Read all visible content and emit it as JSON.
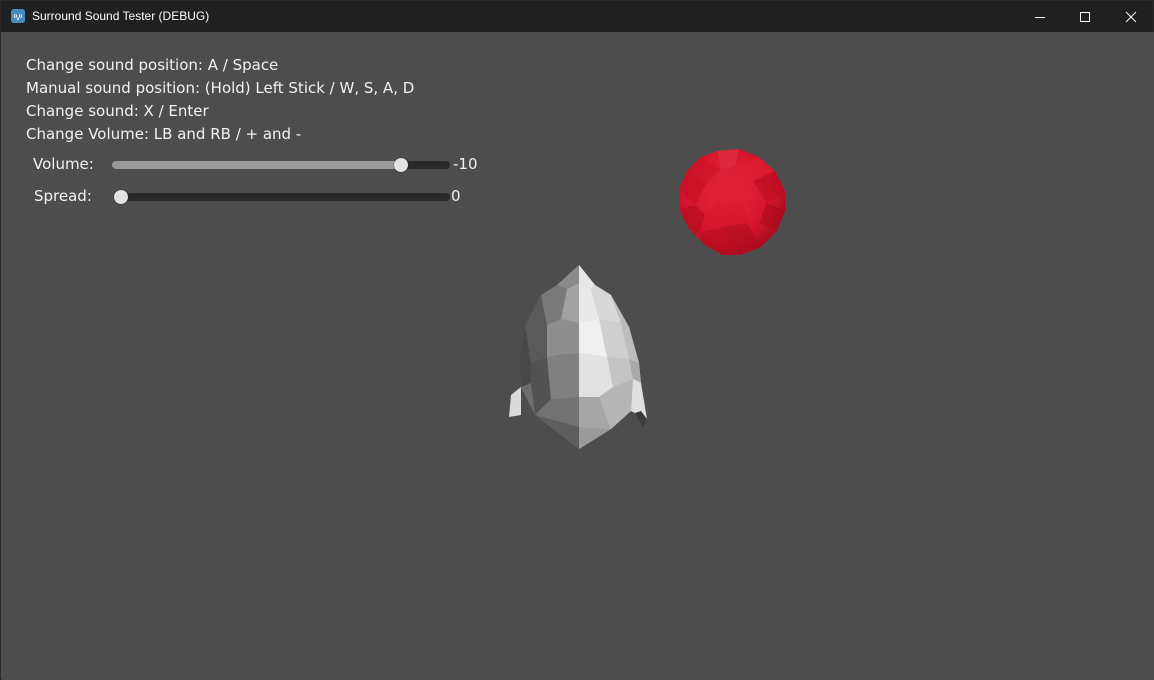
{
  "window": {
    "title": "Surround Sound Tester (DEBUG)",
    "icon": "godot-engine-icon",
    "controls": {
      "minimize": "minimize-icon",
      "maximize": "maximize-icon",
      "close": "close-icon"
    }
  },
  "help": {
    "lines": [
      "Change sound position: A / Space",
      "Manual sound position: (Hold) Left Stick / W, S, A, D",
      "Change sound: X / Enter",
      "Change Volume: LB and RB / + and -"
    ]
  },
  "sliders": {
    "volume": {
      "label": "Volume:",
      "value_text": "-10",
      "fraction": 0.855
    },
    "spread": {
      "label": "Spread:",
      "value_text": "0",
      "fraction": 0.0
    }
  },
  "scene": {
    "sound_source": {
      "shape": "sphere",
      "color": "#d4142a"
    },
    "listener": {
      "shape": "head-mesh",
      "color": "#d9d9d9"
    },
    "background_color": "#4d4d4d"
  }
}
